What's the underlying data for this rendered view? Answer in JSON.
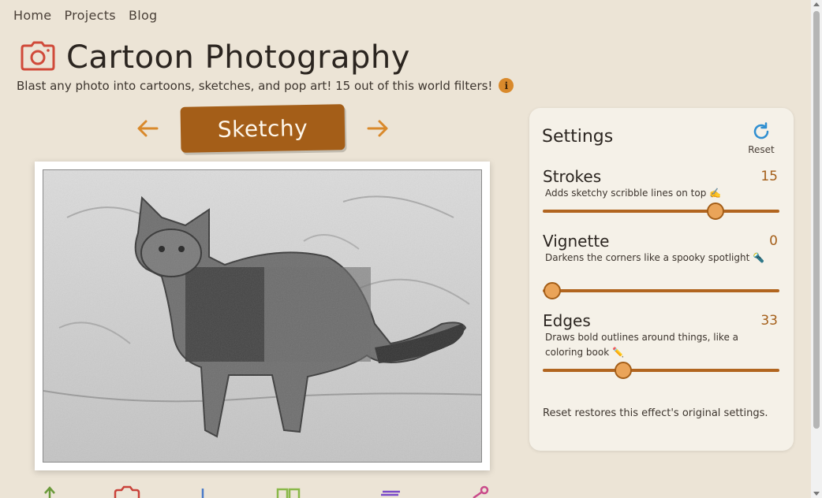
{
  "nav": {
    "items": [
      "Home",
      "Projects",
      "Blog"
    ]
  },
  "header": {
    "title": "Cartoon Photography",
    "subtitle": "Blast any photo into cartoons, sketches, and pop art! 15 out of this world filters!",
    "info_glyph": "i",
    "icon": "camera-icon"
  },
  "effect": {
    "name": "Sketchy",
    "prev_icon": "arrow-left-icon",
    "next_icon": "arrow-right-icon"
  },
  "settings": {
    "title": "Settings",
    "reset_label": "Reset",
    "items": [
      {
        "name": "Strokes",
        "value": "15",
        "description": "Adds sketchy scribble lines on top ✍️",
        "fraction": 0.73
      },
      {
        "name": "Vignette",
        "value": "0",
        "description": "Darkens the corners like a spooky spotlight 🔦",
        "fraction": 0.04
      },
      {
        "name": "Edges",
        "value": "33",
        "description": "Draws bold outlines around things, like a coloring book ✏️",
        "fraction": 0.34
      }
    ],
    "note": "Reset restores this effect's original settings."
  },
  "colors": {
    "accent": "#a45e18",
    "arrow": "#d9892b",
    "background": "#ece4d6",
    "panel": "#f5f1e8"
  }
}
